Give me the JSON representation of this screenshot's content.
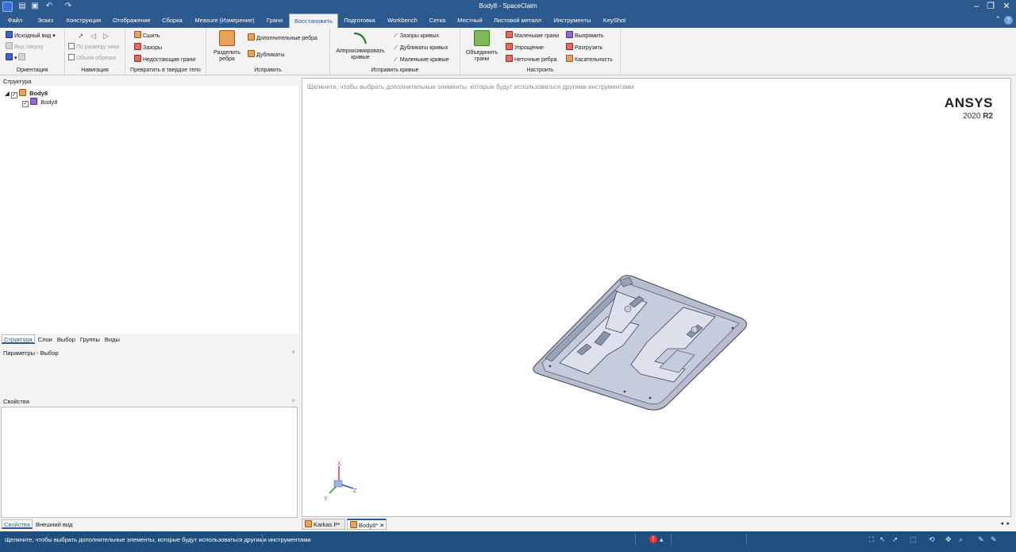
{
  "window": {
    "title": "Body8 - SpaceClaim"
  },
  "menu": {
    "tabs": [
      "Файл",
      "Эскиз",
      "Конструкция",
      "Отображение",
      "Сборка",
      "Measure (Измерение)",
      "Грани",
      "Восстановить",
      "Подготовка",
      "Workbench",
      "Сетка",
      "Местный",
      "Листовой металл",
      "Инструменты",
      "KeyShot"
    ],
    "active": "Восстановить"
  },
  "ribbon": {
    "orientation": {
      "label": "Ориентация",
      "home_view": "Исходный вид",
      "top_view": "Вид сверху"
    },
    "navigation": {
      "label": "Навигация",
      "fit_window": "По размеру окна",
      "clip_volume": "Объем обрезки"
    },
    "solidify": {
      "label": "Превратить в твердое тело",
      "stitch": "Сшить",
      "gaps": "Зазоры",
      "missing_faces": "Недостающие грани"
    },
    "fix": {
      "label": "Исправить",
      "split_edges": "Разделить ребра",
      "extra_edges": "Дополнительные ребра",
      "duplicates": "Дубликаты"
    },
    "fix_curves": {
      "label": "Исправить кривые",
      "fit_curves": "Аппроксимировать кривые",
      "curve_gaps": "Зазоры кривых",
      "duplicate_curves": "Дубликаты кривых",
      "small_curves": "Маленькие кривые"
    },
    "adjust": {
      "label": "Настроить",
      "merge_faces": "Объединить грани",
      "small_faces": "Маленькие грани",
      "simplify": "Упрощение",
      "inexact_edges": "Неточные ребра",
      "straighten": "Выпрямить",
      "relax": "Разгрузить",
      "tangency": "Касательность"
    }
  },
  "structure": {
    "title": "Структура",
    "root": "Body8",
    "child": "Body8",
    "tabs": [
      "Структура",
      "Слои",
      "Выбор",
      "Группы",
      "Виды"
    ]
  },
  "options": {
    "title": "Параметры - Выбор"
  },
  "properties": {
    "title": "Свойства",
    "tabs": [
      "Свойства",
      "Внешний вид"
    ]
  },
  "viewport": {
    "hint": "Щелкните, чтобы выбрать дополнительные элементы, которые будут использоваться другими инструментами",
    "brand": "ANSYS",
    "version": "2020",
    "release": "R2",
    "axes": {
      "x": "X",
      "y": "Y",
      "z": "Z"
    }
  },
  "doc_tabs": [
    "Karkas P*",
    "Body8*"
  ],
  "status": {
    "message": "Щелкните, чтобы выбрать дополнительные элементы, которые будут использоваться другими инструментами"
  }
}
